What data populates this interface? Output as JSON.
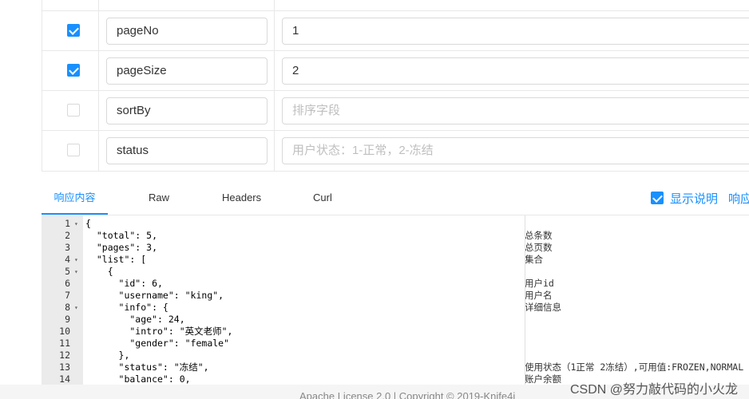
{
  "params": [
    {
      "checked": true,
      "name": "pageNo",
      "value": "1",
      "placeholder": ""
    },
    {
      "checked": true,
      "name": "pageSize",
      "value": "2",
      "placeholder": ""
    },
    {
      "checked": false,
      "name": "sortBy",
      "value": "",
      "placeholder": "排序字段"
    },
    {
      "checked": false,
      "name": "status",
      "value": "",
      "placeholder": "用户状态：1-正常，2-冻结"
    }
  ],
  "tabs": [
    "响应内容",
    "Raw",
    "Headers",
    "Curl"
  ],
  "show_desc_label": "显示说明",
  "response_label_cut": "响应",
  "line_numbers": [
    "1",
    "2",
    "3",
    "4",
    "5",
    "6",
    "7",
    "8",
    "9",
    "10",
    "11",
    "12",
    "13",
    "14"
  ],
  "code_lines": [
    "{",
    "  \"total\": 5,",
    "  \"pages\": 3,",
    "  \"list\": [",
    "    {",
    "      \"id\": 6,",
    "      \"username\": \"king\",",
    "      \"info\": {",
    "        \"age\": 24,",
    "        \"intro\": \"英文老师\",",
    "        \"gender\": \"female\"",
    "      },",
    "      \"status\": \"冻结\",",
    "      \"balance\": 0,"
  ],
  "descriptions": [
    "",
    "总条数",
    "总页数",
    "集合",
    "",
    "用户id",
    "用户名",
    "详细信息",
    "",
    "",
    "",
    "",
    "使用状态（1正常 2冻结）,可用值:FROZEN,NORMAL",
    "账户余额"
  ],
  "footer_text": "Apache License 2.0 | Copyright © 2019-Knife4j",
  "watermark": "CSDN @努力敲代码的小火龙",
  "colors": {
    "accent": "#1890ff",
    "gutter": "#ebebeb",
    "border": "#e8e8e8"
  }
}
